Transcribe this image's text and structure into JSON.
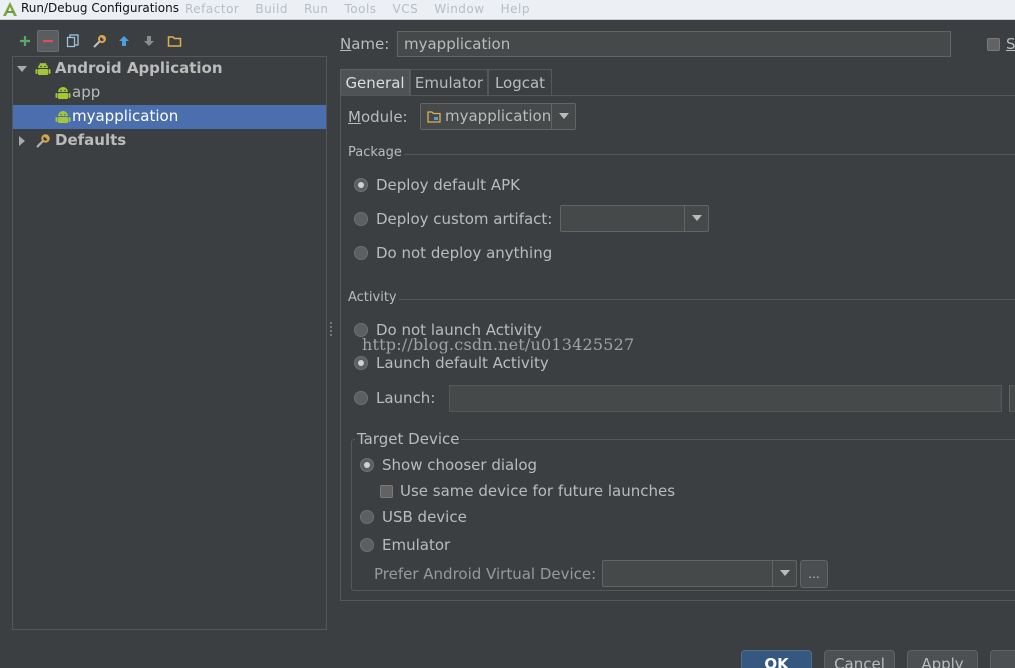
{
  "window": {
    "title": "Run/Debug Configurations",
    "background_menu": [
      "Refactor",
      "Build",
      "Run",
      "Tools",
      "VCS",
      "Window",
      "Help"
    ]
  },
  "toolbar": {
    "icons": [
      "add-icon",
      "remove-icon",
      "copy-icon",
      "edit-defaults-icon",
      "move-up-icon",
      "move-down-icon",
      "folder-icon"
    ]
  },
  "tree": {
    "items": [
      {
        "label": "Android Application",
        "expanded": true
      },
      {
        "label": "app"
      },
      {
        "label": "myapplication",
        "selected": true
      },
      {
        "label": "Defaults",
        "expanded": false
      }
    ]
  },
  "form": {
    "name_label": "Name:",
    "name_value": "myapplication",
    "share_label": "S"
  },
  "tabs": [
    {
      "label": "General",
      "active": true
    },
    {
      "label": "Emulator"
    },
    {
      "label": "Logcat"
    }
  ],
  "general": {
    "module_label": "Module:",
    "module_value": "myapplication",
    "package_section": "Package",
    "deploy_default": "Deploy default APK",
    "deploy_custom": "Deploy custom artifact:",
    "deploy_nothing": "Do not deploy anything",
    "activity_section": "Activity",
    "no_launch": "Do not launch Activity",
    "launch_default": "Launch default Activity",
    "launch": "Launch:",
    "target_device": "Target Device",
    "show_chooser": "Show chooser dialog",
    "use_same_device": "Use same device for future launches",
    "usb_device": "USB device",
    "emulator": "Emulator",
    "prefer_avd": "Prefer Android Virtual Device:",
    "browse": "..."
  },
  "watermark": "http://blog.csdn.net/u013425527",
  "buttons": {
    "ok": "OK",
    "cancel": "Cancel",
    "apply": "Apply"
  },
  "colors": {
    "background": "#3c3f41",
    "selection": "#4b6eaf",
    "primary_button": "#365880",
    "android_green": "#a4c639"
  }
}
